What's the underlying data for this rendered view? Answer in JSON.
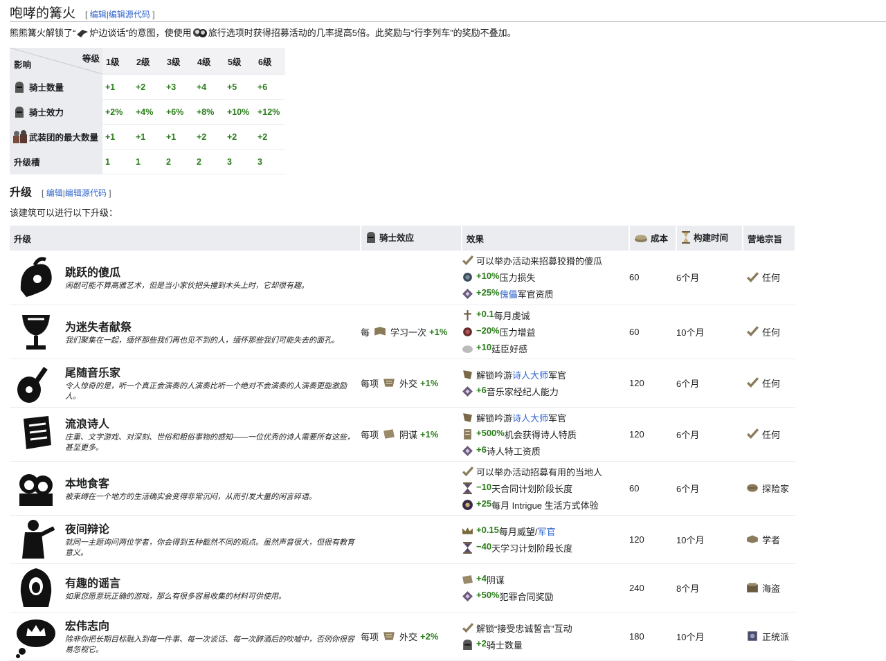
{
  "section1": {
    "title": "咆哮的篝火",
    "edit_open": "[",
    "edit1": "编辑",
    "edit_sep": "|",
    "edit2": "编辑源代码",
    "edit_close": "]",
    "intro_a": "熊熊篝火解锁了“",
    "intro_b": "炉边谈话”的意图，使使用",
    "intro_c": "旅行选项时获得招募活动的几率提高5倍。此奖励与“行李列车”的奖励不叠加。"
  },
  "levels_table": {
    "corner_top": "等级",
    "corner_bottom": "影响",
    "levels": [
      "1级",
      "2级",
      "3级",
      "4级",
      "5级",
      "6级"
    ],
    "rows": [
      {
        "label": "骑士数量",
        "icon": "knight-helmet-icon",
        "values": [
          "+1",
          "+2",
          "+3",
          "+4",
          "+5",
          "+6"
        ]
      },
      {
        "label": "骑士效力",
        "icon": "knight-helmet-icon",
        "values": [
          "+2%",
          "+4%",
          "+6%",
          "+8%",
          "+10%",
          "+12%"
        ]
      },
      {
        "label": "武装团的最大数量",
        "icon": "men-at-arms-icon",
        "values": [
          "+1",
          "+1",
          "+1",
          "+2",
          "+2",
          "+2"
        ]
      },
      {
        "label": "升级槽",
        "icon": "",
        "values": [
          "1",
          "1",
          "2",
          "2",
          "3",
          "3"
        ]
      }
    ]
  },
  "section2": {
    "title": "升级",
    "edit_open": "[",
    "edit1": "编辑",
    "edit_sep": "|",
    "edit2": "编辑源代码",
    "edit_close": "]",
    "subtitle": "该建筑可以进行以下升级："
  },
  "upgrades_table": {
    "headers": {
      "upgrade": "升级",
      "knight": "骑士效应",
      "effect": "效果",
      "cost": "成本",
      "time": "构建时间",
      "camp": "营地宗旨"
    },
    "rows": [
      {
        "name": "跳跃的傻瓜",
        "desc": "闹剧可能不算高雅艺术，但是当小家伙把头撞到木头上时，它却很有趣。",
        "icon": "fool-icon",
        "knight": {
          "prefix": "",
          "icon": "",
          "skill": "",
          "bonus": ""
        },
        "effects": [
          {
            "icon": "check-icon",
            "parts": [
              {
                "t": "可以举办活动来招募狡猾的傻瓜",
                "c": ""
              }
            ]
          },
          {
            "icon": "stress-icon",
            "parts": [
              {
                "t": "+10%",
                "c": "g"
              },
              {
                "t": "压力损失",
                "c": ""
              }
            ]
          },
          {
            "icon": "aptitude-icon",
            "parts": [
              {
                "t": "+25%",
                "c": "g"
              },
              {
                "t": " 傀儡",
                "c": "link"
              },
              {
                "t": "军官资质",
                "c": ""
              }
            ]
          }
        ],
        "cost": "60",
        "time": "6个月",
        "camp": {
          "icon": "check-icon",
          "label": "任何"
        }
      },
      {
        "name": "为迷失者献祭",
        "desc": "我们聚集在一起，缅怀那些我们再也见不到的人，缅怀那些我们可能失去的面孔。",
        "icon": "chalice-icon",
        "knight": {
          "prefix": "每",
          "icon": "learning-icon",
          "skill": "学习一次",
          "bonus": "+1%"
        },
        "effects": [
          {
            "icon": "piety-icon",
            "parts": [
              {
                "t": "+0.1",
                "c": "g"
              },
              {
                "t": "每月虔诚",
                "c": ""
              }
            ]
          },
          {
            "icon": "stress-gain-icon",
            "parts": [
              {
                "t": "−20%",
                "c": "g"
              },
              {
                "t": "压力增益",
                "c": ""
              }
            ]
          },
          {
            "icon": "courtier-icon",
            "parts": [
              {
                "t": "+10",
                "c": "g"
              },
              {
                "t": "廷臣好感",
                "c": ""
              }
            ]
          }
        ],
        "cost": "60",
        "time": "10个月",
        "camp": {
          "icon": "check-icon",
          "label": "任何"
        }
      },
      {
        "name": "尾随音乐家",
        "desc": "令人惊奇的是，听一个真正会演奏的人演奏比听一个绝对不会演奏的人演奏更能激励人。",
        "icon": "lute-icon",
        "knight": {
          "prefix": "每项",
          "icon": "diplomacy-icon",
          "skill": "外交",
          "bonus": "+1%"
        },
        "effects": [
          {
            "icon": "officer-icon",
            "parts": [
              {
                "t": "解锁吟游",
                "c": ""
              },
              {
                "t": "诗人大师",
                "c": "link"
              },
              {
                "t": "军官",
                "c": ""
              }
            ]
          },
          {
            "icon": "aptitude-icon",
            "parts": [
              {
                "t": "+6",
                "c": "g"
              },
              {
                "t": "音乐家经纪人能力",
                "c": ""
              }
            ]
          }
        ],
        "cost": "120",
        "time": "6个月",
        "camp": {
          "icon": "check-icon",
          "label": "任何"
        }
      },
      {
        "name": "流浪诗人",
        "desc": "庄重、文字游戏、对深刻、世俗和粗俗事物的感知——一位优秀的诗人需要所有这些，甚至更多。",
        "icon": "scroll-icon",
        "knight": {
          "prefix": "每项",
          "icon": "intrigue-icon",
          "skill": "阴谋",
          "bonus": "+1%"
        },
        "effects": [
          {
            "icon": "officer-icon",
            "parts": [
              {
                "t": "解锁吟游",
                "c": ""
              },
              {
                "t": "诗人大师",
                "c": "link"
              },
              {
                "t": "军官",
                "c": ""
              }
            ]
          },
          {
            "icon": "trait-icon",
            "parts": [
              {
                "t": "+500%",
                "c": "g"
              },
              {
                "t": "机会获得诗人特质",
                "c": ""
              }
            ]
          },
          {
            "icon": "aptitude-icon",
            "parts": [
              {
                "t": "+6",
                "c": "g"
              },
              {
                "t": "诗人特工资质",
                "c": ""
              }
            ]
          }
        ],
        "cost": "120",
        "time": "6个月",
        "camp": {
          "icon": "check-icon",
          "label": "任何"
        }
      },
      {
        "name": "本地食客",
        "desc": "被束缚在一个地方的生活确实会变得非常沉闷，从而引发大量的闲言碎语。",
        "icon": "gossips-icon",
        "knight": {
          "prefix": "",
          "icon": "",
          "skill": "",
          "bonus": ""
        },
        "effects": [
          {
            "icon": "check-icon",
            "parts": [
              {
                "t": "可以举办活动招募有用的当地人",
                "c": ""
              }
            ]
          },
          {
            "icon": "hourglass-icon",
            "parts": [
              {
                "t": "−10",
                "c": "g"
              },
              {
                "t": "天合同计划阶段长度",
                "c": ""
              }
            ]
          },
          {
            "icon": "lifestyle-icon",
            "parts": [
              {
                "t": "+25",
                "c": "g"
              },
              {
                "t": "每月 Intrigue 生活方式体验",
                "c": ""
              }
            ]
          }
        ],
        "cost": "60",
        "time": "6个月",
        "camp": {
          "icon": "explorer-icon",
          "label": "探险家"
        }
      },
      {
        "name": "夜间辩论",
        "desc": "就同一主题询问两位学者，你会得到五种截然不同的观点。虽然声音很大，但很有教育意义。",
        "icon": "orator-icon",
        "knight": {
          "prefix": "",
          "icon": "",
          "skill": "",
          "bonus": ""
        },
        "effects": [
          {
            "icon": "crown-icon",
            "parts": [
              {
                "t": "+0.15",
                "c": "g"
              },
              {
                "t": "每月威望/",
                "c": ""
              },
              {
                "t": "军官",
                "c": "link"
              }
            ]
          },
          {
            "icon": "hourglass-icon",
            "parts": [
              {
                "t": "−40",
                "c": "g"
              },
              {
                "t": "天学习计划阶段长度",
                "c": ""
              }
            ]
          }
        ],
        "cost": "120",
        "time": "10个月",
        "camp": {
          "icon": "scholar-icon",
          "label": "学者"
        }
      },
      {
        "name": "有趣的谣言",
        "desc": "如果您愿意玩正确的游戏，那么有很多容易收集的材料可供使用。",
        "icon": "hooded-icon",
        "knight": {
          "prefix": "",
          "icon": "",
          "skill": "",
          "bonus": ""
        },
        "effects": [
          {
            "icon": "intrigue-icon",
            "parts": [
              {
                "t": "+4",
                "c": "g"
              },
              {
                "t": "阴谋",
                "c": ""
              }
            ]
          },
          {
            "icon": "aptitude-icon",
            "parts": [
              {
                "t": "+50%",
                "c": "g"
              },
              {
                "t": "犯罪合同奖励",
                "c": ""
              }
            ]
          }
        ],
        "cost": "240",
        "time": "8个月",
        "camp": {
          "icon": "pirate-icon",
          "label": "海盗"
        }
      },
      {
        "name": "宏伟志向",
        "desc": "除非你把长期目标融入到每一件事、每一次谈话、每一次醉酒后的吹嘘中，否则你很容易忽视它。",
        "icon": "ambition-icon",
        "knight": {
          "prefix": "每项",
          "icon": "diplomacy-icon",
          "skill": "外交",
          "bonus": "+2%"
        },
        "effects": [
          {
            "icon": "check-icon",
            "parts": [
              {
                "t": "解锁“接受忠诚誓言”互动",
                "c": ""
              }
            ]
          },
          {
            "icon": "knight-helmet-icon",
            "parts": [
              {
                "t": "+2",
                "c": "g"
              },
              {
                "t": "骑士数量",
                "c": ""
              }
            ]
          }
        ],
        "cost": "180",
        "time": "10个月",
        "camp": {
          "icon": "legitimist-icon",
          "label": "正统派"
        }
      }
    ]
  }
}
